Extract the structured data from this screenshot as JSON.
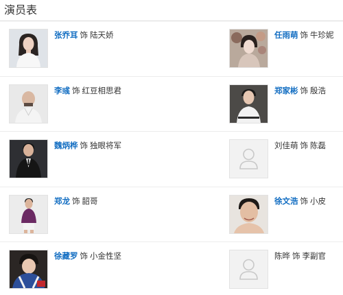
{
  "section": {
    "title": "演员表"
  },
  "colors": {
    "link": "#136ec2",
    "text": "#333333",
    "divider": "#ececec",
    "placeholder_bg": "#f2f2f2"
  },
  "cast": [
    {
      "actor": "张乔耳",
      "as": "饰",
      "role": "陆天娇",
      "linked": true,
      "photo": "photo-woman-white-top"
    },
    {
      "actor": "任雨萌",
      "as": "饰",
      "role": "牛珍妮",
      "linked": true,
      "photo": "photo-woman-flowers"
    },
    {
      "actor": "李彧",
      "as": "饰",
      "role": "红豆相思君",
      "linked": true,
      "photo": "photo-bald-man"
    },
    {
      "actor": "郑家彬",
      "as": "饰",
      "role": "殷浩",
      "linked": true,
      "photo": "photo-man-white-shirt"
    },
    {
      "actor": "魏炳桦",
      "as": "饰",
      "role": "独眼将军",
      "linked": true,
      "photo": "photo-man-black-suit"
    },
    {
      "actor": "刘佳萌",
      "as": "饰",
      "role": "陈磊",
      "linked": false,
      "photo": "avatar-placeholder-icon"
    },
    {
      "actor": "郑龙",
      "as": "饰",
      "role": "韶哥",
      "linked": true,
      "photo": "photo-man-purple-shirt"
    },
    {
      "actor": "徐文浩",
      "as": "饰",
      "role": "小皮",
      "linked": true,
      "photo": "photo-man-portrait"
    },
    {
      "actor": "徐藏罗",
      "as": "饰",
      "role": "小金性坚",
      "linked": true,
      "photo": "photo-child-blue-jacket"
    },
    {
      "actor": "陈晔",
      "as": "饰",
      "role": "李副官",
      "linked": false,
      "photo": "avatar-placeholder-icon"
    }
  ]
}
